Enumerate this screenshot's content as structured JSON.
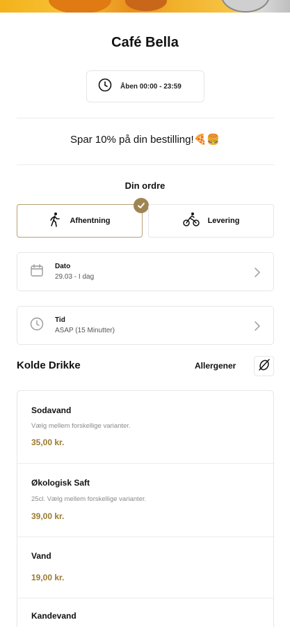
{
  "restaurant": {
    "name": "Café Bella"
  },
  "hours": {
    "text": "Åben 00:00 - 23:59"
  },
  "promo": {
    "text": "Spar 10% på din bestilling!🍕🍔"
  },
  "order": {
    "title": "Din ordre",
    "options": [
      {
        "label": "Afhentning",
        "icon": "walking-person-icon",
        "selected": true
      },
      {
        "label": "Levering",
        "icon": "cyclist-icon",
        "selected": false
      }
    ],
    "date": {
      "label": "Dato",
      "value": "29.03 - I dag",
      "icon": "calendar-icon"
    },
    "time": {
      "label": "Tid",
      "value": "ASAP (15 Minutter)",
      "icon": "clock-icon"
    }
  },
  "menu": {
    "section_title": "Kolde Drikke",
    "allergen_label": "Allergener",
    "accent_color": "#9a7a2e",
    "items": [
      {
        "name": "Sodavand",
        "description": "Vælg mellem forskellige varianter.",
        "price": "35,00 kr."
      },
      {
        "name": "Økologisk Saft",
        "description": "25cl. Vælg mellem forskellige varianter.",
        "price": "39,00 kr."
      },
      {
        "name": "Vand",
        "description": "",
        "price": "19,00 kr."
      },
      {
        "name": "Kandevand",
        "description": "",
        "price": ""
      }
    ]
  }
}
